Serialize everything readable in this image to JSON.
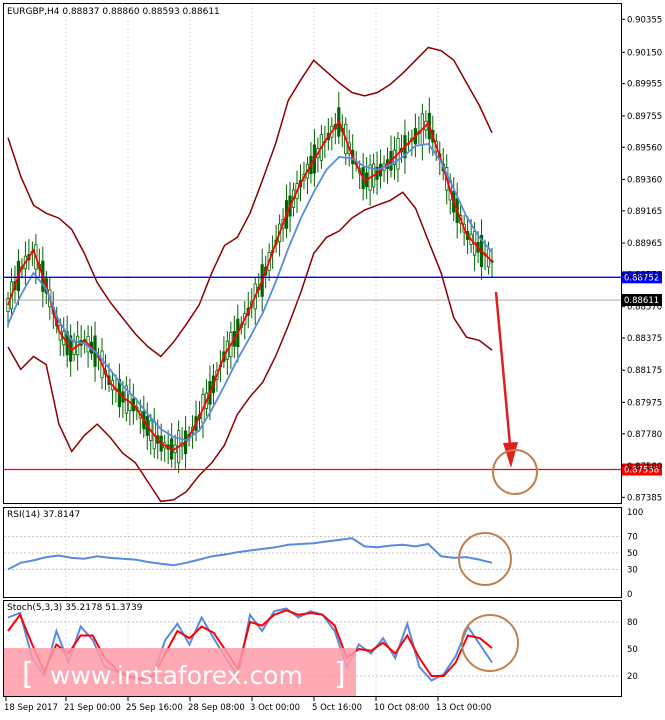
{
  "chart_data": [
    {
      "type": "line",
      "panel": "price",
      "title": "EURGBP,H4 0.88837 0.88860 0.88593 0.88611",
      "symbol": "EURGBP",
      "timeframe": "H4",
      "ohlc_header": {
        "open": 0.88837,
        "high": 0.8886,
        "low": 0.88593,
        "close": 0.88611
      },
      "x_tick_labels": [
        "18 Sep 2017",
        "21 Sep 00:00",
        "25 Sep 16:00",
        "28 Sep 08:00",
        "3 Oct 00:00",
        "5 Oct 16:00",
        "10 Oct 08:00",
        "13 Oct 00:00"
      ],
      "y_tick_labels": [
        "0.90355",
        "0.90150",
        "0.89955",
        "0.89755",
        "0.89560",
        "0.89360",
        "0.89165",
        "0.88965",
        "0.88770",
        "0.88570",
        "0.88375",
        "0.88175",
        "0.87975",
        "0.87780",
        "0.87580",
        "0.87385"
      ],
      "ylim": [
        0.8735,
        0.9045
      ],
      "grid": true,
      "series": [
        {
          "values": [
            0.8858,
            0.888,
            0.8892,
            0.887,
            0.8842,
            0.883,
            0.8836,
            0.8828,
            0.881,
            0.8801,
            0.8795,
            0.8782,
            0.8772,
            0.8768,
            0.8773,
            0.8788,
            0.8806,
            0.8827,
            0.884,
            0.8856,
            0.8874,
            0.8896,
            0.8917,
            0.8934,
            0.8948,
            0.8961,
            0.8972,
            0.8951,
            0.8935,
            0.894,
            0.8947,
            0.8955,
            0.8963,
            0.8971,
            0.8948,
            0.8922,
            0.8902,
            0.8893,
            0.8885
          ]
        },
        {
          "values": [
            0.8846,
            0.8864,
            0.8878,
            0.8868,
            0.8848,
            0.8836,
            0.8834,
            0.8828,
            0.8818,
            0.8808,
            0.88,
            0.879,
            0.8781,
            0.8776,
            0.8774,
            0.878,
            0.8793,
            0.8808,
            0.8824,
            0.8838,
            0.8853,
            0.8872,
            0.8893,
            0.8912,
            0.8928,
            0.8942,
            0.895,
            0.8949,
            0.8944,
            0.8942,
            0.8945,
            0.895,
            0.8957,
            0.8958,
            0.8947,
            0.893,
            0.8913,
            0.89,
            0.8891
          ]
        },
        {
          "values": [
            0.8962,
            0.8938,
            0.892,
            0.8915,
            0.8912,
            0.8905,
            0.889,
            0.8872,
            0.886,
            0.885,
            0.884,
            0.8832,
            0.8826,
            0.8835,
            0.8846,
            0.8858,
            0.8878,
            0.8895,
            0.89,
            0.8915,
            0.8936,
            0.8958,
            0.8985,
            0.8998,
            0.901,
            0.9003,
            0.8996,
            0.899,
            0.8988,
            0.899,
            0.8995,
            0.9002,
            0.901,
            0.9018,
            0.9016,
            0.901,
            0.8996,
            0.8982,
            0.8965
          ]
        },
        {
          "values": [
            0.8832,
            0.8818,
            0.8826,
            0.8821,
            0.8784,
            0.8767,
            0.8777,
            0.8784,
            0.8776,
            0.8766,
            0.876,
            0.8748,
            0.8736,
            0.8737,
            0.8742,
            0.8752,
            0.876,
            0.8771,
            0.879,
            0.8801,
            0.881,
            0.8826,
            0.8845,
            0.8866,
            0.889,
            0.89,
            0.8904,
            0.8912,
            0.8917,
            0.892,
            0.8923,
            0.8928,
            0.8918,
            0.8898,
            0.8878,
            0.885,
            0.8838,
            0.8836,
            0.883
          ]
        }
      ],
      "price_lines": [
        {
          "label": "0.88752",
          "value": 0.88752,
          "color": "#0000ff"
        },
        {
          "label": "0.87558",
          "value": 0.87558,
          "color": "#ff0000"
        }
      ],
      "current_price": "0.88611",
      "colors": {
        "candles": "#006400",
        "ma_fast": "#ff0000",
        "ma_slow": "#5a8ae0",
        "bands": "#8b0000",
        "support": "#ff0000",
        "resistance": "#0000ff",
        "forecast_arrow": "#e02020",
        "target_circle": "#c08050"
      }
    },
    {
      "type": "line",
      "panel": "rsi",
      "title": "RSI(14) 37.8147",
      "y_tick_labels": [
        "100",
        "70",
        "50",
        "30",
        "0"
      ],
      "ylim": [
        0,
        100
      ],
      "levels": [
        70,
        50,
        30
      ],
      "series": [
        {
          "values": [
            30,
            38,
            41,
            45,
            47,
            44,
            43,
            46,
            44,
            43,
            42,
            39,
            37,
            35,
            38,
            42,
            46,
            48,
            51,
            53,
            55,
            57,
            60,
            61,
            62,
            64,
            66,
            68,
            58,
            57,
            59,
            60,
            58,
            61,
            46,
            44,
            45,
            42,
            38
          ]
        }
      ],
      "colors": {
        "line": "#5a8ae0"
      }
    },
    {
      "type": "line",
      "panel": "stochastic",
      "title": "Stoch(5,3,3) 35.2178 51.3739",
      "y_tick_labels": [
        "80",
        "50",
        "20"
      ],
      "ylim": [
        0,
        100
      ],
      "levels": [
        80,
        20
      ],
      "series": [
        {
          "values": [
            85,
            90,
            40,
            20,
            70,
            35,
            75,
            60,
            30,
            25,
            18,
            15,
            22,
            60,
            78,
            55,
            85,
            62,
            40,
            20,
            88,
            70,
            92,
            95,
            85,
            92,
            88,
            70,
            30,
            55,
            45,
            62,
            40,
            78,
            30,
            15,
            22,
            42,
            75,
            55,
            35
          ]
        },
        {
          "values": [
            70,
            88,
            55,
            25,
            55,
            45,
            65,
            65,
            40,
            27,
            20,
            17,
            20,
            45,
            70,
            62,
            75,
            68,
            48,
            28,
            80,
            76,
            88,
            93,
            88,
            90,
            88,
            76,
            40,
            50,
            48,
            57,
            45,
            65,
            40,
            20,
            20,
            35,
            65,
            62,
            51
          ]
        }
      ],
      "colors": {
        "k": "#5a8ae0",
        "d": "#ff0000"
      }
    }
  ],
  "watermark": {
    "text": "www.instaforex.com"
  }
}
